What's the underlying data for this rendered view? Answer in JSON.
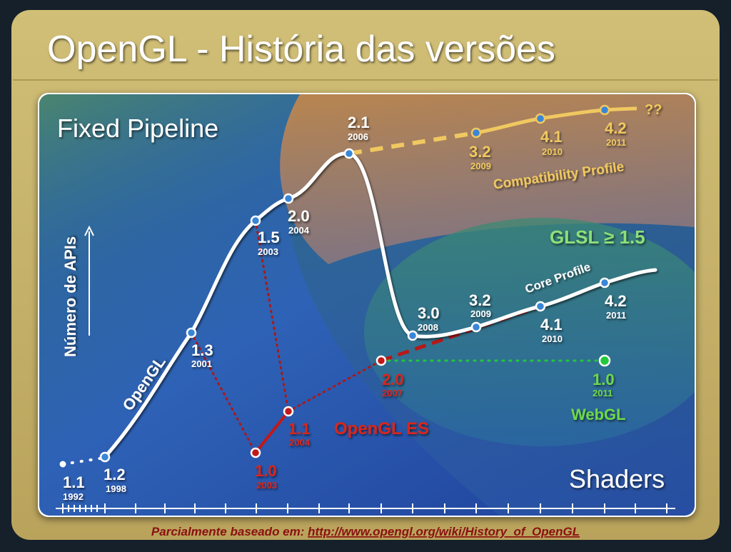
{
  "slide": {
    "title": "OpenGL - História das versões",
    "footer_prefix": "Parcialmente baseado em: ",
    "footer_link": "http://www.opengl.org/wiki/History_of_OpenGL"
  },
  "regions": {
    "fixed_pipeline": "Fixed Pipeline",
    "shaders": "Shaders",
    "glsl": "GLSL ≥ 1.5"
  },
  "axis": {
    "ylabel": "Número de APIs"
  },
  "series_labels": {
    "opengl": "OpenGL",
    "opengl_es": "OpenGL ES",
    "webgl": "WebGL",
    "compatibility_profile": "Compatibility Profile",
    "core_profile": "Core Profile",
    "future": "??"
  },
  "colors": {
    "frame_gold": "#c8b46a",
    "opengl_line": "#ffffff",
    "compat_line": "#f0c860",
    "es_line": "#c21818",
    "webgl_line": "#22c83a",
    "point_fill": "#3a86d6",
    "footer_text": "#8a1010"
  },
  "versions": {
    "opengl": [
      {
        "version": "1.1",
        "year": "1992"
      },
      {
        "version": "1.2",
        "year": "1998"
      },
      {
        "version": "1.3",
        "year": "2001"
      },
      {
        "version": "1.5",
        "year": "2003"
      },
      {
        "version": "2.0",
        "year": "2004"
      },
      {
        "version": "2.1",
        "year": "2006"
      },
      {
        "version": "3.0",
        "year": "2008"
      }
    ],
    "core_profile": [
      {
        "version": "3.2",
        "year": "2009"
      },
      {
        "version": "4.1",
        "year": "2010"
      },
      {
        "version": "4.2",
        "year": "2011"
      }
    ],
    "compatibility_profile": [
      {
        "version": "3.2",
        "year": "2009"
      },
      {
        "version": "4.1",
        "year": "2010"
      },
      {
        "version": "4.2",
        "year": "2011"
      }
    ],
    "opengl_es": [
      {
        "version": "1.0",
        "year": "2003"
      },
      {
        "version": "1.1",
        "year": "2004"
      },
      {
        "version": "2.0",
        "year": "2007"
      }
    ],
    "webgl": [
      {
        "version": "1.0",
        "year": "2011"
      }
    ]
  }
}
